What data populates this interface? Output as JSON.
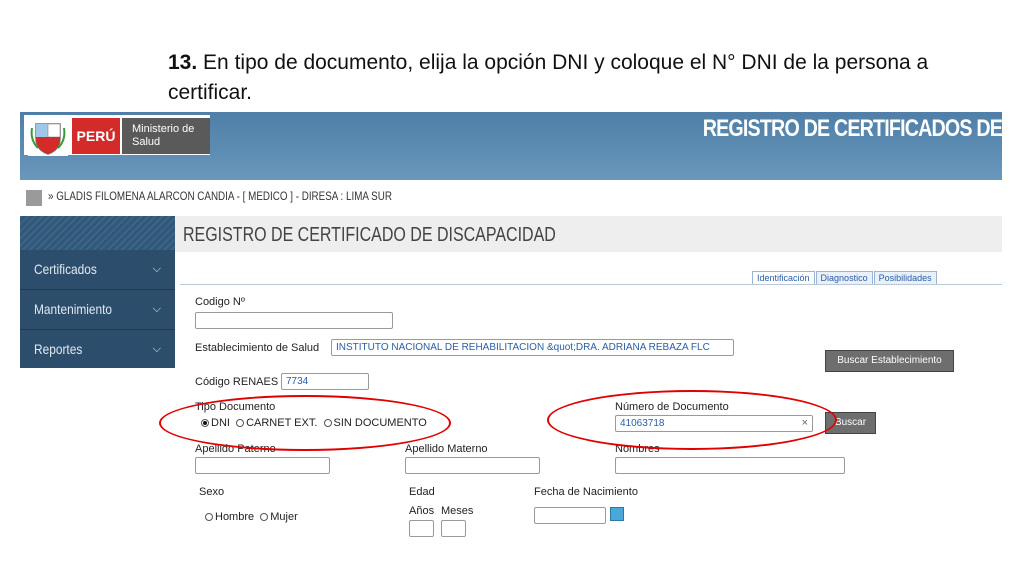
{
  "slide": {
    "step_number": "13.",
    "instruction": "En tipo de documento, elija la opción DNI y coloque el N° DNI de la persona a certificar."
  },
  "header": {
    "logo_country": "PERÚ",
    "logo_ministry": "Ministerio de Salud",
    "banner_title": "REGISTRO DE CERTIFICADOS DE"
  },
  "user_bar": {
    "text": "» GLADIS FILOMENA ALARCON CANDIA - [ MEDICO ] - DIRESA : LIMA SUR"
  },
  "sidebar": {
    "items": [
      {
        "label": "Certificados"
      },
      {
        "label": "Mantenimiento"
      },
      {
        "label": "Reportes"
      }
    ]
  },
  "main": {
    "page_title": "REGISTRO DE CERTIFICADO DE DISCAPACIDAD",
    "tabs": [
      "Identificación",
      "Diagnostico",
      "Posibilidades"
    ],
    "active_tab": "Identificación"
  },
  "form": {
    "codigo_label": "Codigo Nº",
    "codigo_value": "",
    "establecimiento_label": "Establecimiento de Salud",
    "establecimiento_value": "INSTITUTO NACIONAL DE REHABILITACION &quot;DRA. ADRIANA REBAZA FLC",
    "buscar_establecimiento": "Buscar Establecimiento",
    "renaes_label": "Código RENAES",
    "renaes_value": "7734",
    "tipo_documento_label": "Tipo Documento",
    "tipo_options": [
      "DNI",
      "CARNET EXT.",
      "SIN DOCUMENTO"
    ],
    "tipo_selected": "DNI",
    "numero_documento_label": "Número de Documento",
    "numero_documento_value": "41063718",
    "clear_glyph": "×",
    "buscar": "Buscar",
    "apellido_paterno_label": "Apellido Paterno",
    "apellido_materno_label": "Apellido Materno",
    "nombres_label": "Nombres",
    "sexo_label": "Sexo",
    "sexo_options": [
      "Hombre",
      "Mujer"
    ],
    "edad_label": "Edad",
    "anios_label": "Años",
    "meses_label": "Meses",
    "fecha_nacimiento_label": "Fecha de Nacimiento"
  },
  "colors": {
    "banner": "#5e8db3",
    "sidebar": "#2c4e6c",
    "highlight_ellipse": "#e00000",
    "logo_red": "#d32a2a"
  }
}
